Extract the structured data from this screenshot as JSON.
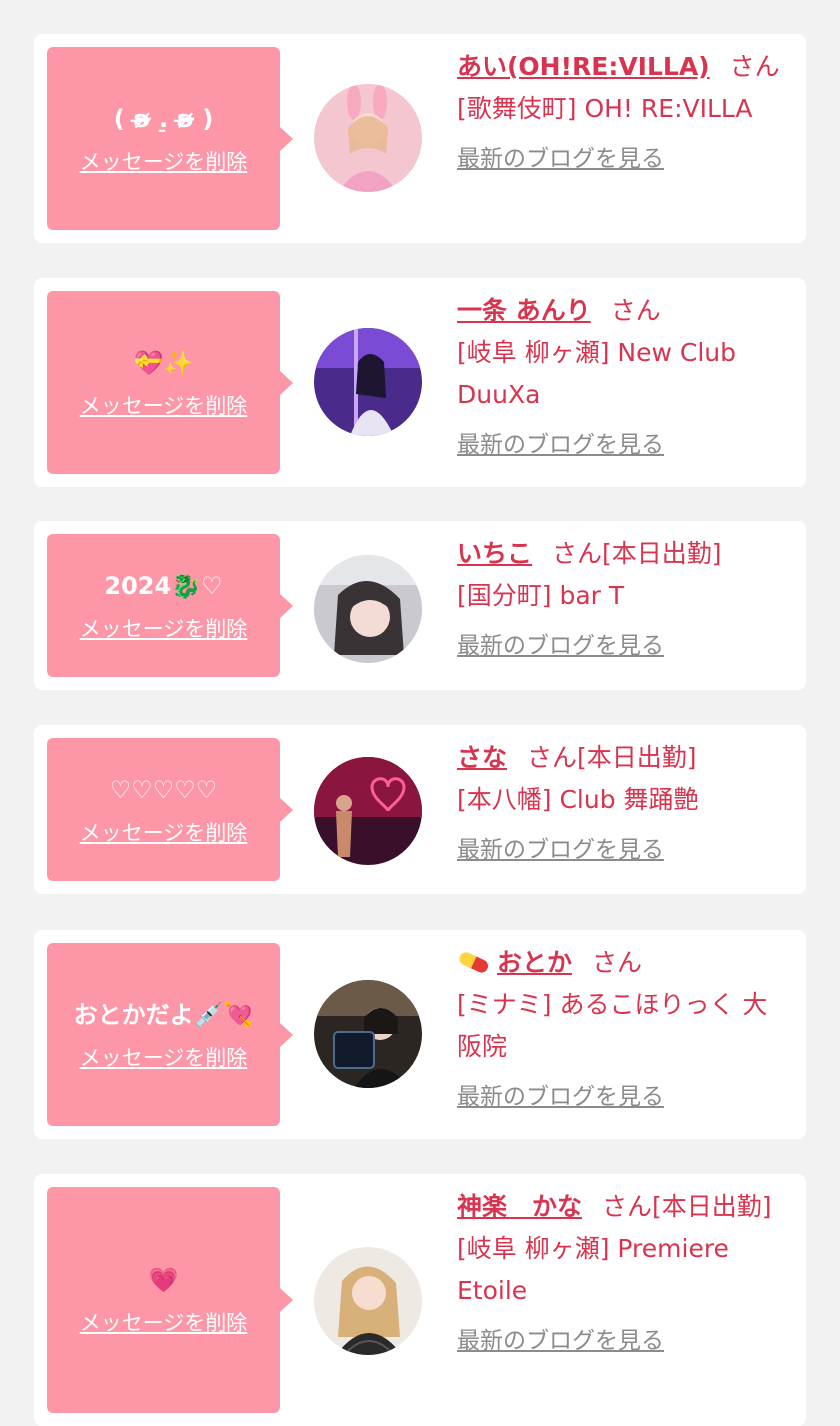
{
  "colors": {
    "page_bg": "#f2f2f2",
    "card_bg": "#ffffff",
    "bubble_pink": "#fd97a8",
    "accent_text": "#d9344f",
    "link_gray": "#8b8b8b"
  },
  "delete_label": "メッセージを削除",
  "blog_label": "最新のブログを見る",
  "items": [
    {
      "message": "( ʚ̴̶̷̷ .̠ ʚ̴̶̷̷ )",
      "name": "あい(OH!RE:VILLA)",
      "honorific": "さん",
      "shop": "[歌舞伎町] OH! RE:VILLA",
      "avatar_icon": "bunny-ears-photo"
    },
    {
      "message": "💝✨",
      "name": "一条 あんり",
      "honorific": "さん",
      "shop": "[岐阜 柳ヶ瀬] New Club DuuXa",
      "avatar_icon": "purple-light-photo"
    },
    {
      "message": "2024🐉♡",
      "name": "いちこ",
      "honorific": "さん[本日出勤]",
      "shop": "[国分町] bar T",
      "avatar_icon": "selfie-photo"
    },
    {
      "message": "♡♡♡♡♡",
      "name": "さな",
      "honorific": "さん[本日出勤]",
      "shop": "[本八幡] Club 舞踊艶",
      "avatar_icon": "neon-love-photo"
    },
    {
      "message": "おとかだよ💉💘",
      "name": "おとか",
      "name_prefix_icon": "pill-icon",
      "honorific": "さん",
      "shop": "[ミナミ] あるこほりっく 大阪院",
      "avatar_icon": "dark-bar-photo"
    },
    {
      "message": "💗",
      "name": "神楽　かな",
      "honorific": "さん[本日出勤]",
      "shop": "[岐阜 柳ヶ瀬] Premiere Etoile",
      "avatar_icon": "blonde-portrait-photo"
    }
  ]
}
